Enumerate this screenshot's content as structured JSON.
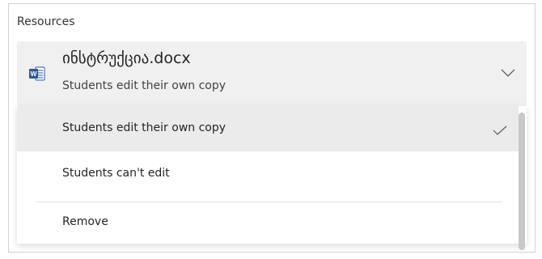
{
  "panel": {
    "heading": "Resources"
  },
  "resource": {
    "icon": "word-doc-icon",
    "file_name": "ინსტრუქცია.docx",
    "mode": "Students edit their own copy"
  },
  "menu": {
    "items": [
      {
        "label": "Students edit their own copy",
        "selected": true
      },
      {
        "label": "Students can't edit",
        "selected": false
      },
      {
        "label": "Remove",
        "selected": false
      }
    ]
  },
  "colors": {
    "word_blue": "#2b579a",
    "card_bg": "#f0f0f0",
    "selected_bg": "#ebebeb"
  }
}
